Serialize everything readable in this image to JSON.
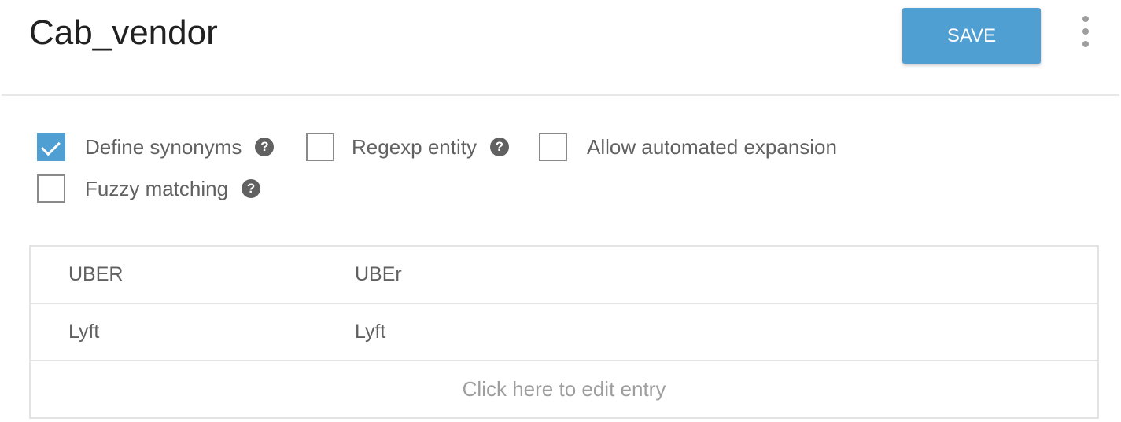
{
  "header": {
    "title": "Cab_vendor",
    "save_label": "SAVE",
    "more_icon": "more-vertical-icon",
    "save_color": "#4f9fd3"
  },
  "options": [
    {
      "label": "Define synonyms",
      "checked": true,
      "help_icon": "help-icon"
    },
    {
      "label": "Regexp entity",
      "checked": false,
      "help_icon": "help-icon"
    },
    {
      "label": "Allow automated expansion",
      "checked": false
    },
    {
      "label": "Fuzzy matching",
      "checked": false,
      "help_icon": "help-icon"
    }
  ],
  "help_glyph": "?",
  "entries": [
    {
      "value": "UBER",
      "synonyms": "UBEr"
    },
    {
      "value": "Lyft",
      "synonyms": "Lyft"
    }
  ],
  "edit_entry_placeholder": "Click here to edit entry"
}
